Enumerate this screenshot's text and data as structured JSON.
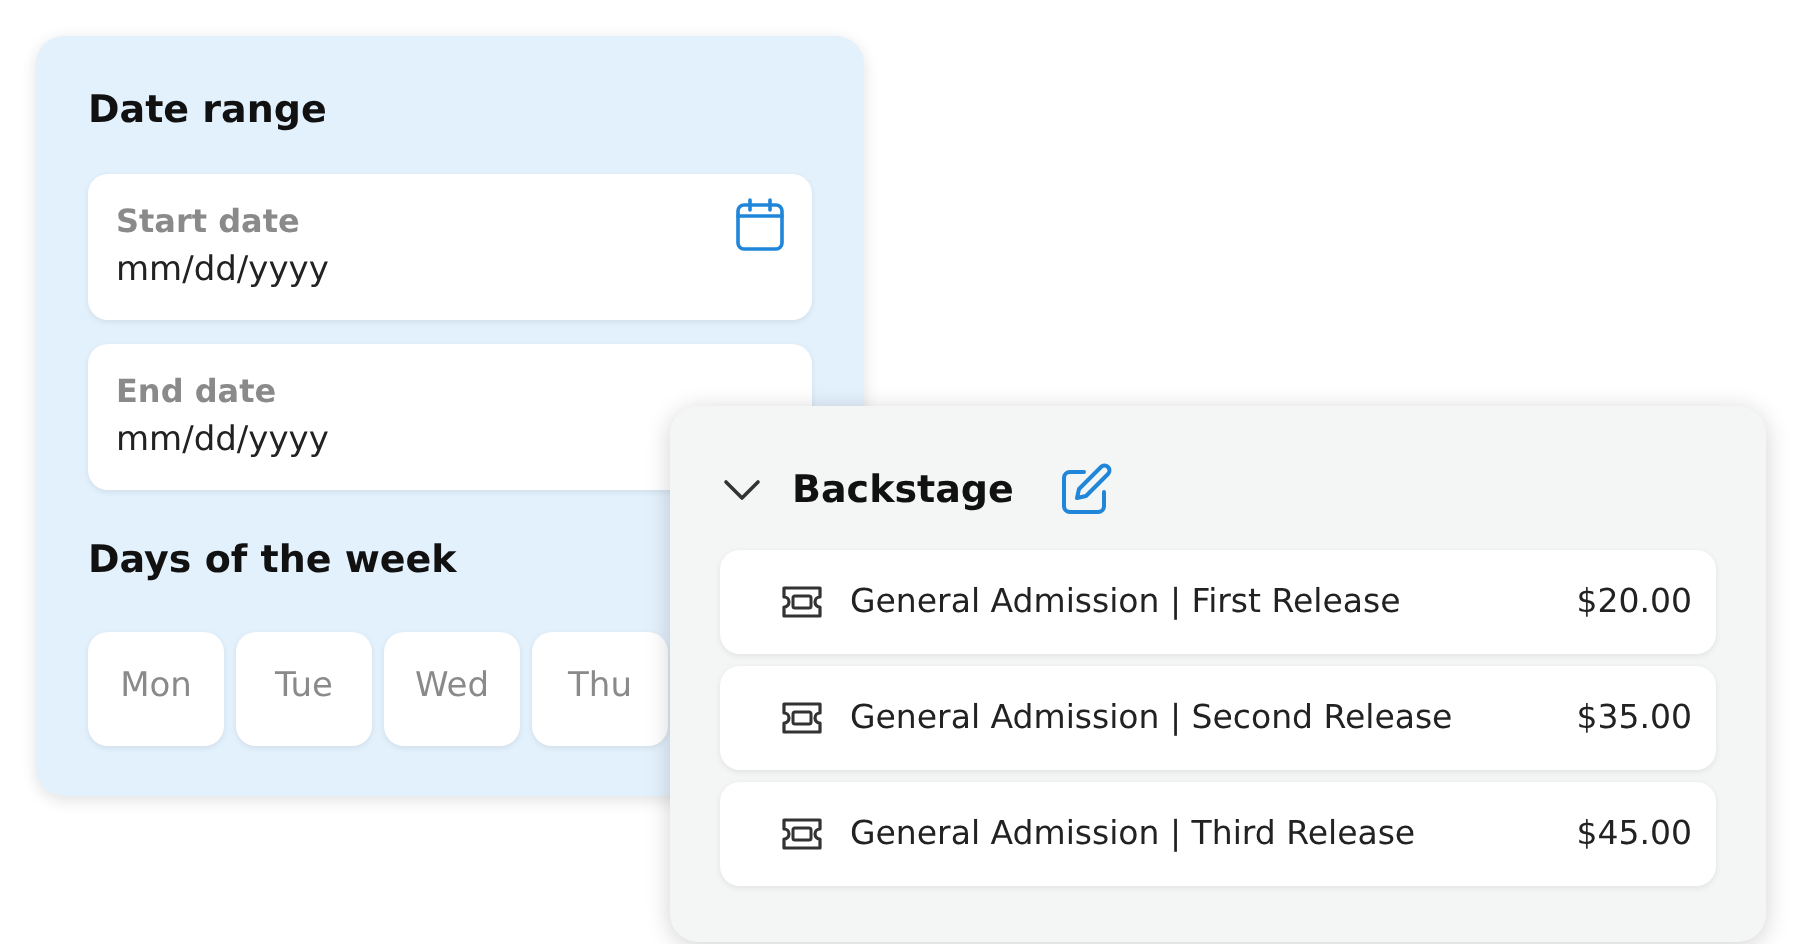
{
  "date_range": {
    "title": "Date range",
    "fields": [
      {
        "label": "Start date",
        "placeholder": "mm/dd/yyyy",
        "kind": "with-icon"
      },
      {
        "label": "End date",
        "placeholder": "mm/dd/yyyy",
        "kind": "plain"
      }
    ],
    "days_title": "Days of the week",
    "days": [
      "Mon",
      "Tue",
      "Wed",
      "Thu"
    ]
  },
  "section": {
    "title": "Backstage",
    "expanded": true,
    "tickets": [
      {
        "name": "General Admission | First Release",
        "price": "$20.00"
      },
      {
        "name": "General Admission | Second Release",
        "price": "$35.00"
      },
      {
        "name": "General Admission | Third Release",
        "price": "$45.00"
      }
    ]
  }
}
